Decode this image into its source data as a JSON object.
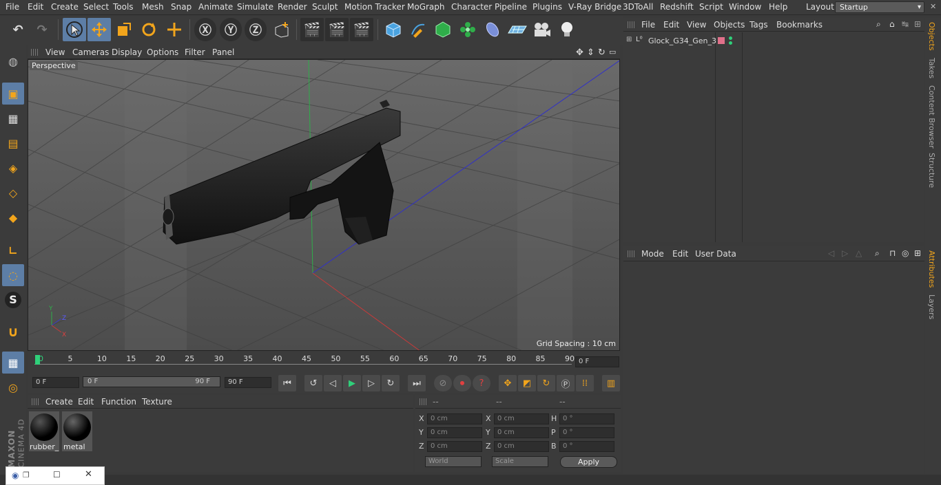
{
  "menu": [
    "File",
    "Edit",
    "Create",
    "Select",
    "Tools",
    "Mesh",
    "Snap",
    "Animate",
    "Simulate",
    "Render",
    "Sculpt",
    "Motion Tracker",
    "MoGraph",
    "Character",
    "Pipeline",
    "Plugins",
    "V-Ray Bridge",
    "3DToAll",
    "Redshift",
    "Script",
    "Window",
    "Help"
  ],
  "layout": {
    "label": "Layout:",
    "value": "Startup"
  },
  "viewport": {
    "menu": [
      "View",
      "Cameras",
      "Display",
      "Options",
      "Filter",
      "Panel"
    ],
    "camera_label": "Perspective",
    "grid_spacing": "Grid Spacing : 10 cm"
  },
  "timeline": {
    "ticks": [
      "0",
      "5",
      "10",
      "15",
      "20",
      "25",
      "30",
      "35",
      "40",
      "45",
      "50",
      "55",
      "60",
      "65",
      "70",
      "75",
      "80",
      "85",
      "90"
    ],
    "current_frame": "0 F"
  },
  "transport": {
    "start": "0 F",
    "range_start": "0 F",
    "range_end": "90 F",
    "end": "90 F"
  },
  "materials": {
    "menu": [
      "Create",
      "Edit",
      "Function",
      "Texture"
    ],
    "items": [
      {
        "name": "rubber_"
      },
      {
        "name": "metal"
      }
    ]
  },
  "coords": {
    "headers": [
      "--",
      "--",
      "--"
    ],
    "rows": [
      {
        "a": "X",
        "av": "0 cm",
        "b": "X",
        "bv": "0 cm",
        "c": "H",
        "cv": "0 °"
      },
      {
        "a": "Y",
        "av": "0 cm",
        "b": "Y",
        "bv": "0 cm",
        "c": "P",
        "cv": "0 °"
      },
      {
        "a": "Z",
        "av": "0 cm",
        "b": "Z",
        "bv": "0 cm",
        "c": "B",
        "cv": "0 °"
      }
    ],
    "space": "World",
    "mode": "Scale",
    "apply": "Apply"
  },
  "objects": {
    "menu": [
      "File",
      "Edit",
      "View",
      "Objects",
      "Tags",
      "Bookmarks"
    ],
    "items": [
      {
        "name": "Glock_G34_Gen_3"
      }
    ]
  },
  "attributes": {
    "menu": [
      "Mode",
      "Edit",
      "User Data"
    ]
  },
  "right_tabs": [
    "Objects",
    "Takes",
    "Content Browser",
    "Structure",
    "Attributes",
    "Layers"
  ],
  "brand": {
    "top": "MAXON",
    "bottom": "CINEMA 4D"
  },
  "colors": {
    "accent": "#5d7ea6",
    "x_axis": "#c83a3a",
    "y_axis": "#3aa83a",
    "z_axis": "#3a3ac8"
  }
}
